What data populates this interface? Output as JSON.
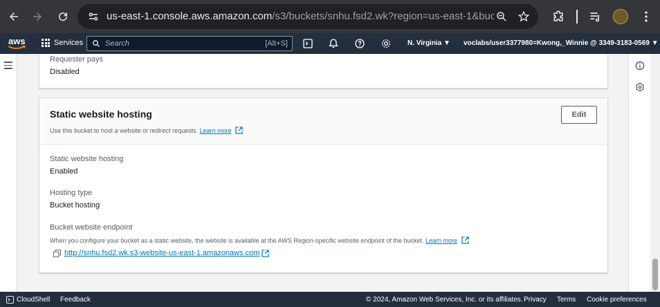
{
  "browser": {
    "url_host": "us-east-1.console.aws.amazon.com",
    "url_path": "/s3/buckets/snhu.fsd2.wk?region=us-east-1&bucket..."
  },
  "aws_nav": {
    "logo": "aws",
    "services_label": "Services",
    "search_placeholder": "Search",
    "search_shortcut": "[Alt+S]",
    "region": "N. Virginia ▼",
    "account": "voclabs/user3377980=Kwong,_Winnie @ 3349-3183-0569 ▼"
  },
  "prev_section": {
    "label": "Requester pays",
    "value": "Disabled"
  },
  "static_hosting": {
    "title": "Static website hosting",
    "edit_label": "Edit",
    "description": "Use this bucket to host a website or redirect requests.",
    "learn_more": "Learn more",
    "status_label": "Static website hosting",
    "status_value": "Enabled",
    "type_label": "Hosting type",
    "type_value": "Bucket hosting",
    "endpoint_label": "Bucket website endpoint",
    "endpoint_desc": "When you configure your bucket as a static website, the website is available at the AWS Region-specific website endpoint of the bucket.",
    "endpoint_learn_more": "Learn more",
    "endpoint_url": "http://snhu.fsd2.wk.s3-website-us-east-1.amazonaws.com"
  },
  "footer": {
    "cloudshell": "CloudShell",
    "feedback": "Feedback",
    "copyright": "© 2024, Amazon Web Services, Inc. or its affiliates.",
    "privacy": "Privacy",
    "terms": "Terms",
    "cookies": "Cookie preferences"
  },
  "colors": {
    "aws_nav_bg": "#232f3e",
    "link": "#0073bb",
    "browser_bg": "#35363a"
  }
}
